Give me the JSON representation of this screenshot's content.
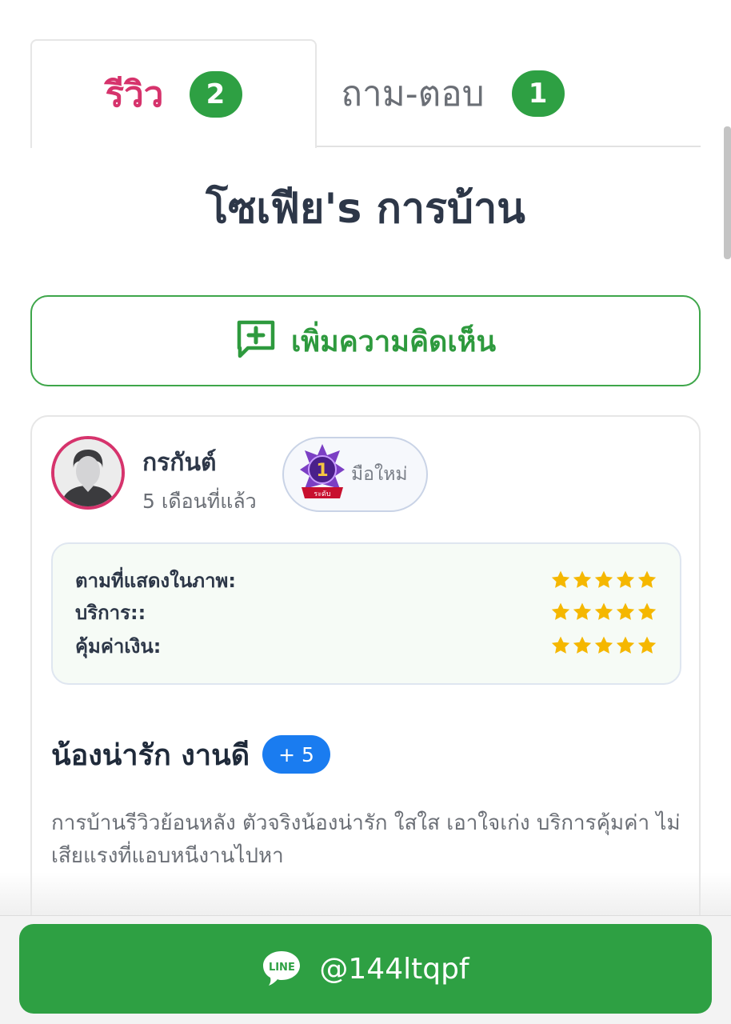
{
  "tabs": [
    {
      "label": "รีวิว",
      "count": "2",
      "active": true
    },
    {
      "label": "ถาม-ตอบ",
      "count": "1",
      "active": false
    }
  ],
  "product_title": "โซเฟีย's การบ้าน",
  "add_comment": {
    "label": "เพิ่มความคิดเห็น",
    "icon": "comment-plus-icon"
  },
  "review": {
    "reviewer_name": "กรกันต์",
    "time_ago": "5 เดือนที่แล้ว",
    "level": {
      "number": "1",
      "ribbon": "ระดับ",
      "label": "มือใหม่"
    },
    "ratings": [
      {
        "label": "ตามที่แสดงในภาพ:",
        "stars": 5
      },
      {
        "label": "บริการ::",
        "stars": 5
      },
      {
        "label": "คุ้มค่าเงิน:",
        "stars": 5
      }
    ],
    "headline": "น้องน่ารัก งานดี",
    "points_badge": "+ 5",
    "body_line1": "การบ้านรีวิวย้อนหลัง ตัวจริงน้องน่ารัก ใสใส เอาใจเก่ง บริการคุ้มค่า ไม่",
    "body_line2": "เสียแรงที่แอบหนีงานไปหา"
  },
  "line_contact": {
    "logo_text": "LINE",
    "id": "@144ltqpf"
  },
  "colors": {
    "accent_pink": "#d6336c",
    "green": "#2ea043",
    "star": "#f5b700",
    "blue_badge": "#1a7cf0"
  }
}
